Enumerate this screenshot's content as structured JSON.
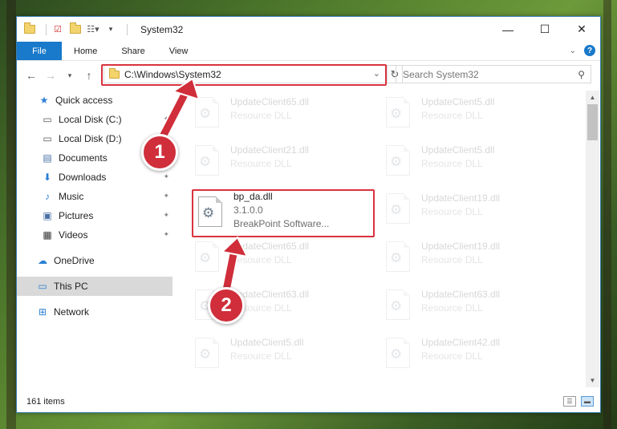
{
  "window": {
    "title": "System32",
    "controls": {
      "minimize": "—",
      "maximize": "☐",
      "close": "✕"
    }
  },
  "ribbon": {
    "tabs": [
      "File",
      "Home",
      "Share",
      "View"
    ]
  },
  "address": {
    "path": "C:\\Windows\\System32",
    "search_placeholder": "Search System32"
  },
  "sidebar": {
    "items": [
      {
        "label": "Quick access",
        "icon": "star-icon"
      },
      {
        "label": "Local Disk (C:)",
        "icon": "drive-icon"
      },
      {
        "label": "Local Disk (D:)",
        "icon": "drive-icon"
      },
      {
        "label": "Documents",
        "icon": "documents-icon"
      },
      {
        "label": "Downloads",
        "icon": "download-icon"
      },
      {
        "label": "Music",
        "icon": "music-icon"
      },
      {
        "label": "Pictures",
        "icon": "pictures-icon"
      },
      {
        "label": "Videos",
        "icon": "videos-icon"
      },
      {
        "label": "OneDrive",
        "icon": "cloud-icon"
      },
      {
        "label": "This PC",
        "icon": "computer-icon"
      },
      {
        "label": "Network",
        "icon": "network-icon"
      }
    ]
  },
  "files": {
    "left": [
      {
        "name": "UpdateClient65.dll",
        "sub": "Resource DLL"
      },
      {
        "name": "UpdateClient21.dll",
        "sub": "Resource DLL"
      },
      {
        "name": "bp_da.dll",
        "sub": "3.1.0.0",
        "sub2": "BreakPoint Software..."
      },
      {
        "name": "UpdateClient65.dll",
        "sub": "Resource DLL"
      },
      {
        "name": "UpdateClient63.dll",
        "sub": "Resource DLL"
      },
      {
        "name": "UpdateClient5.dll",
        "sub": "Resource DLL"
      }
    ],
    "right": [
      {
        "name": "UpdateClient5.dll",
        "sub": "Resource DLL"
      },
      {
        "name": "UpdateClient5.dll",
        "sub": "Resource DLL"
      },
      {
        "name": "UpdateClient19.dll",
        "sub": "Resource DLL"
      },
      {
        "name": "UpdateClient19.dll",
        "sub": "Resource DLL"
      },
      {
        "name": "UpdateClient63.dll",
        "sub": "Resource DLL"
      },
      {
        "name": "UpdateClient42.dll",
        "sub": "Resource DLL"
      }
    ]
  },
  "status": {
    "item_count": "161 items"
  },
  "annotations": {
    "step1": "1",
    "step2": "2"
  },
  "colors": {
    "accent": "#1979ca",
    "highlight": "#d9333f"
  }
}
